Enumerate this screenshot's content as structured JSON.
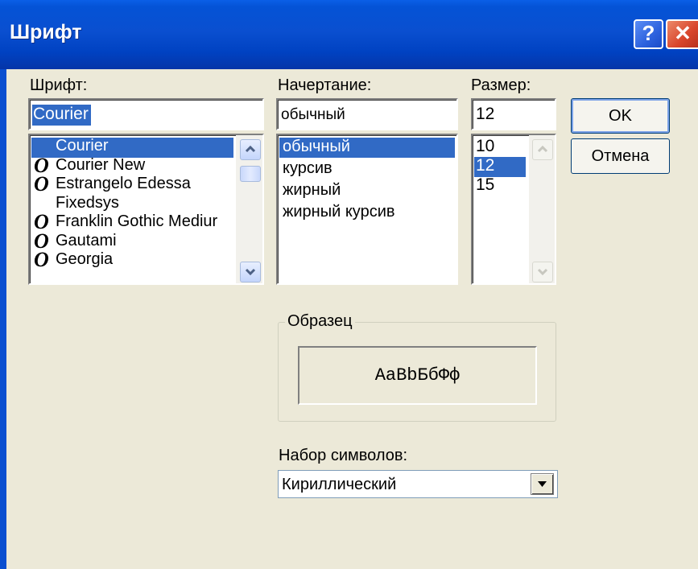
{
  "window": {
    "title": "Шрифт",
    "help_glyph": "?",
    "close_glyph": "✕"
  },
  "font": {
    "label": "Шрифт:",
    "value": "Courier",
    "items": [
      {
        "label": "Courier",
        "truetype": false,
        "selected": true
      },
      {
        "label": "Courier New",
        "truetype": true,
        "selected": false
      },
      {
        "label": "Estrangelo Edessa",
        "truetype": true,
        "selected": false
      },
      {
        "label": "Fixedsys",
        "truetype": false,
        "selected": false
      },
      {
        "label": "Franklin Gothic Mediur",
        "truetype": true,
        "selected": false
      },
      {
        "label": "Gautami",
        "truetype": true,
        "selected": false
      },
      {
        "label": "Georgia",
        "truetype": true,
        "selected": false
      }
    ]
  },
  "style": {
    "label": "Начертание:",
    "value": "обычный",
    "items": [
      "обычный",
      "курсив",
      "жирный",
      "жирный курсив"
    ]
  },
  "size": {
    "label": "Размер:",
    "value": "12",
    "items": [
      "10",
      "12",
      "15"
    ]
  },
  "buttons": {
    "ok": "OK",
    "cancel": "Отмена"
  },
  "sample": {
    "legend": "Образец",
    "text": "AaBbБбФф"
  },
  "charset": {
    "label": "Набор символов:",
    "value": "Кириллический"
  },
  "icons": {
    "truetype": "O",
    "scroll_up": "chevron-up-icon",
    "scroll_down": "chevron-down-icon",
    "dropdown": "triangle-down-icon"
  },
  "colors": {
    "selection": "#316ac5",
    "dialog": "#ece9d8",
    "titlebar": "#0a4fd0"
  }
}
